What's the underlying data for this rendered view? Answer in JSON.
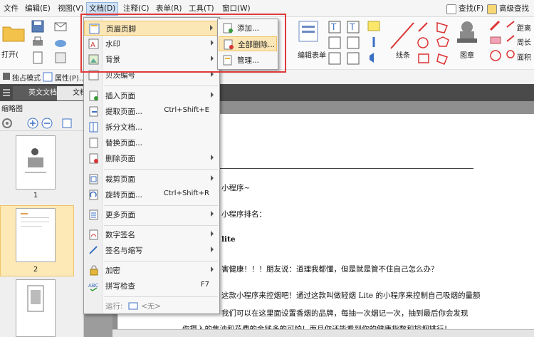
{
  "menubar": {
    "items": [
      "文件",
      "编辑(E)",
      "视图(V)",
      "文档(D)",
      "注释(C)",
      "表单(R)",
      "工具(T)",
      "窗口(W)"
    ],
    "find_label": "查找(F)",
    "adv_find_label": "高级查找"
  },
  "ribbon": {
    "open_label": "打开(",
    "form_label": "编辑表单",
    "line_label": "线条",
    "stamp_label": "图章",
    "distance_label": "距离",
    "perimeter_label": "周长",
    "area_label": "面积"
  },
  "toolbar2": {
    "exclusive_mode": "独占模式",
    "properties": "属性(P)..."
  },
  "tabs": {
    "items": [
      "英文文档",
      "文档"
    ]
  },
  "thumbpanel": {
    "title": "缩略图",
    "pages": [
      "1",
      "2"
    ]
  },
  "document": {
    "lines": [
      "小程序~",
      "小程序排名：",
      "lite",
      "害健康！！！朋友说：道理我都懂，但是就是管不住自己怎么办？",
      "这款小程序来控烟吧！通过这款叫做轻烟 Lite 的小程序来控制自己吸烟的量额",
      "我们可以在这里面设置香烟的品牌，每抽一次烟记一次，抽到最后你会发现",
      "你摄入的焦油和花费的金钱多的可怕！而且你还能看到你的健康指数和控烟排行！"
    ]
  },
  "dropdown": {
    "items": [
      {
        "label": "页眉页脚",
        "shortcut": "",
        "submenu": true
      },
      {
        "label": "水印",
        "shortcut": "",
        "submenu": true
      },
      {
        "label": "背景",
        "shortcut": "",
        "submenu": true
      },
      {
        "label": "贝茨编号",
        "shortcut": "",
        "submenu": true
      },
      {
        "label": "插入页面",
        "shortcut": "",
        "submenu": true
      },
      {
        "label": "提取页面...",
        "shortcut": "Ctrl+Shift+E",
        "submenu": false
      },
      {
        "label": "拆分文档...",
        "shortcut": "",
        "submenu": false
      },
      {
        "label": "替换页面...",
        "shortcut": "",
        "submenu": false
      },
      {
        "label": "删除页面",
        "shortcut": "",
        "submenu": true
      },
      {
        "label": "裁剪页面",
        "shortcut": "",
        "submenu": true
      },
      {
        "label": "旋转页面...",
        "shortcut": "Ctrl+Shift+R",
        "submenu": false
      },
      {
        "label": "更多页面",
        "shortcut": "",
        "submenu": true
      },
      {
        "label": "数字签名",
        "shortcut": "",
        "submenu": true
      },
      {
        "label": "签名与缩写",
        "shortcut": "",
        "submenu": true
      },
      {
        "label": "加密",
        "shortcut": "",
        "submenu": true
      },
      {
        "label": "拼写检查",
        "shortcut": "F7",
        "submenu": false
      }
    ],
    "run_label": "运行:",
    "run_value": "<无>"
  },
  "submenu": {
    "items": [
      "添加...",
      "全部删除...",
      "管理..."
    ]
  },
  "colors": {
    "highlight": "#fbe6b6",
    "red_box": "#e03a3a",
    "tabs_bg": "#4a4a4a"
  }
}
